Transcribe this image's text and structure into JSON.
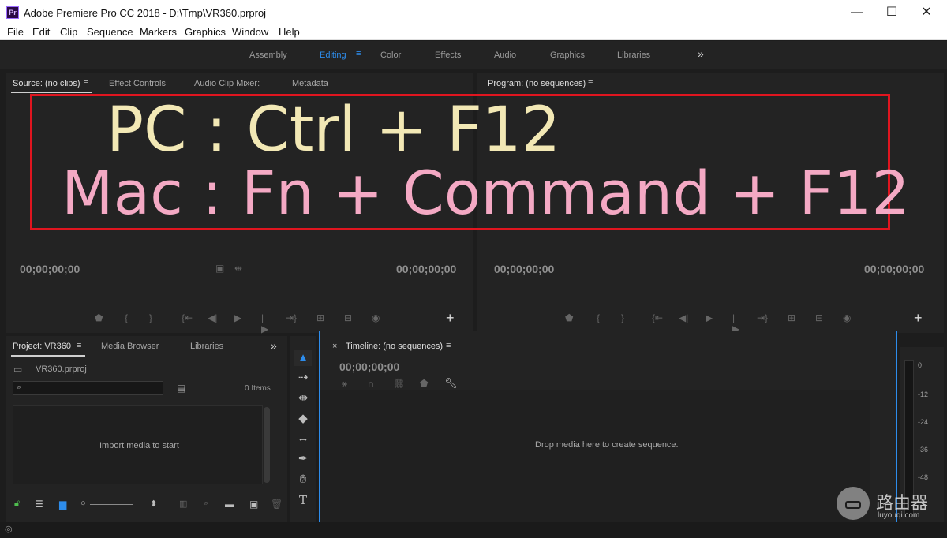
{
  "window": {
    "app_icon": "Pr",
    "title": "Adobe Premiere Pro CC 2018 - D:\\Tmp\\VR360.prproj",
    "minimize": "—",
    "maximize": "☐",
    "close": "✕"
  },
  "menu": [
    "File",
    "Edit",
    "Clip",
    "Sequence",
    "Markers",
    "Graphics",
    "Window",
    "Help"
  ],
  "workspaces": {
    "tabs": [
      "Assembly",
      "Editing",
      "Color",
      "Effects",
      "Audio",
      "Graphics",
      "Libraries"
    ],
    "active": "Editing",
    "more": "»"
  },
  "source_panel": {
    "tabs": [
      "Source: (no clips)",
      "Effect Controls",
      "Audio Clip Mixer:",
      "Metadata"
    ],
    "timecode_left": "00;00;00;00",
    "timecode_right": "00;00;00;00",
    "add": "+"
  },
  "program_panel": {
    "tab": "Program: (no sequences)",
    "timecode_left": "00;00;00;00",
    "timecode_right": "00;00;00;00",
    "add": "+"
  },
  "annotation": {
    "pc": "PC : Ctrl + F12",
    "mac": "Mac : Fn + Command + F12",
    "box_color": "#e0151f",
    "pc_color": "#f2e8b5",
    "mac_color": "#f4a9c4"
  },
  "project_panel": {
    "tabs": [
      "Project: VR360",
      "Media Browser",
      "Libraries"
    ],
    "more": "»",
    "file": "VR360.prproj",
    "items_count": "0 Items",
    "empty_message": "Import media to start"
  },
  "timeline_panel": {
    "close": "×",
    "tab": "Timeline: (no sequences)",
    "timecode": "00;00;00;00",
    "empty_message": "Drop media here to create sequence."
  },
  "audio_meter": {
    "labels": [
      "0",
      "-12",
      "-24",
      "-36",
      "-48"
    ]
  },
  "watermark": {
    "name": "路由器",
    "url": "luyouqi.com"
  },
  "accent_color": "#2d8ceb"
}
